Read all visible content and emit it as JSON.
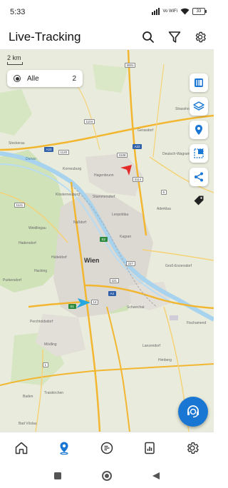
{
  "status_bar": {
    "time": "5:33",
    "network_label": "Vo WiFi",
    "battery": "33"
  },
  "header": {
    "title": "Live-Tracking",
    "icons": [
      "search-icon",
      "filter-icon",
      "settings-icon"
    ]
  },
  "map": {
    "scale_label": "2 km",
    "filter": {
      "label": "Alle",
      "count": "2"
    },
    "city_label": "Wien",
    "place_labels": {
      "stockerau": "Stockerau",
      "korneuburg": "Korneuburg",
      "klosterneuburg": "Klosterneuburg",
      "stammersdorf": "Stammersdorf",
      "leopoldau": "Leopoldau",
      "kagran": "Kagran",
      "nussdorf": "Nußdorf",
      "weidlingau": "Weidlingau",
      "hadersdorf": "Hadersdorf",
      "huetteldorf": "Hütteldorf",
      "hacking": "Hacking",
      "purkersdorf": "Purkersdorf",
      "perchtoldsdorf": "Perchtoldsdorf",
      "moedling": "Mödling",
      "traiskirchen": "Traiskirchen",
      "baden": "Baden",
      "bad_voeslau": "Bad Vöslau",
      "schwechat": "Schwechat",
      "gross_enzersdorf": "Groß-Enzersdorf",
      "fischamend": "Fischamend",
      "strasshof": "Strasshof",
      "deutsch_wagram": "Deutsch-Wagram",
      "gerasdorf": "Gerasdorf",
      "hagenbrunn": "Hagenbrunn",
      "himberg": "Himberg",
      "lanzendorf": "Lanzendorf",
      "aderklaa": "Aderklaa",
      "donau": "Donau"
    },
    "road_labels": [
      "A22",
      "A23",
      "A4",
      "S1",
      "S2",
      "E49",
      "E461",
      "E59",
      "1120",
      "1121",
      "1104",
      "3108",
      "3114",
      "6",
      "7",
      "227",
      "221",
      "228",
      "1",
      "14",
      "A21",
      "3001",
      "3007"
    ],
    "markers": [
      {
        "name": "red-marker",
        "color": "#e32b2b"
      },
      {
        "name": "blue-marker",
        "color": "#26a7df"
      }
    ],
    "tools": [
      "map-style-icon",
      "layers-icon",
      "location-pin-icon",
      "crop-area-icon",
      "share-icon",
      "tag-icon"
    ]
  },
  "fab": {
    "icon": "support-agent-icon"
  },
  "bottom_nav": {
    "items": [
      "home-icon",
      "map-pin-icon",
      "chat-icon",
      "reports-icon",
      "settings-icon"
    ],
    "active": "map-pin-icon"
  },
  "colors": {
    "accent": "#1976d2",
    "map_land": "#e9ecdc",
    "water": "#a8d3ee",
    "urban": "#d9d6d2"
  }
}
